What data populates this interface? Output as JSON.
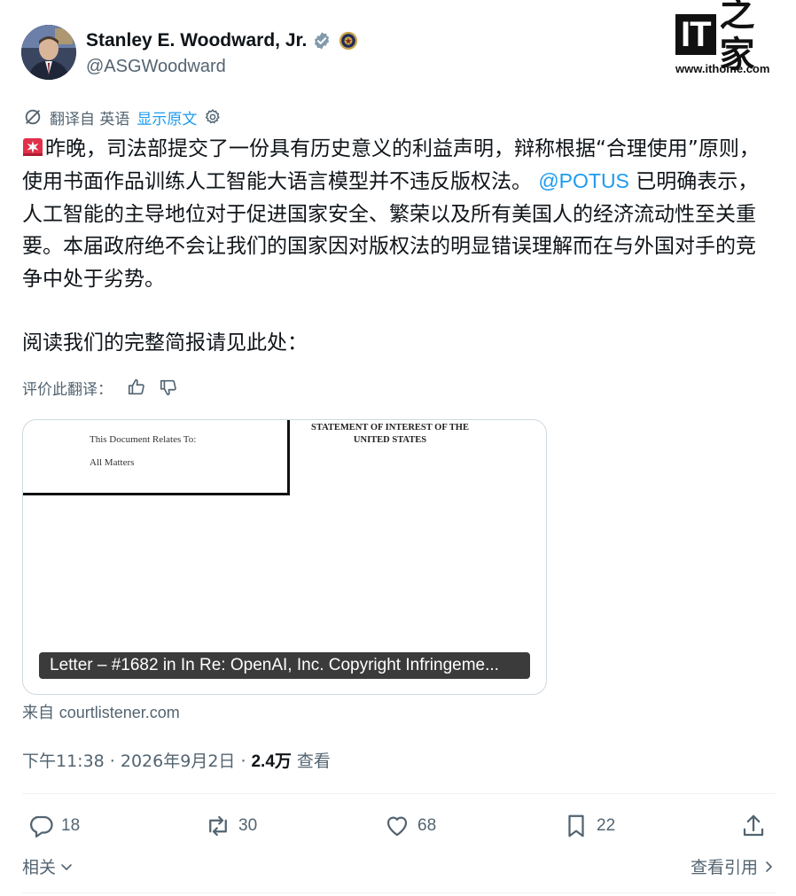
{
  "author": {
    "name": "Stanley E. Woodward, Jr.",
    "handle": "@ASGWoodward"
  },
  "watermark": {
    "logo_it": "IT",
    "logo_zh": "之家",
    "url": "www.ithome.com"
  },
  "translation": {
    "label": "翻译自 英语",
    "show_original": "显示原文"
  },
  "tweet": {
    "text_before_mention": "昨晚，司法部提交了一份具有历史意义的利益声明，辩称根据“合理使用”原则，使用书面作品训练人工智能大语言模型并不违反版权法。",
    "mention": "@POTUS",
    "text_after_mention": "已明确表示，人工智能的主导地位对于促进国家安全、繁荣以及所有美国人的经济流动性至关重要。本届政府绝不会让我们的国家因对版权法的明显错误理解而在与外国对手的竞争中处于劣势。",
    "paragraph2": "阅读我们的完整简报请见此处："
  },
  "rate_translation": "评价此翻译：",
  "card": {
    "doc_relates": "This Document Relates To:",
    "doc_all_matters": "All Matters",
    "doc_statement_line1": "STATEMENT OF INTEREST OF THE",
    "doc_statement_line2": "UNITED STATES",
    "caption": "Letter – #1682 in In Re: OpenAI, Inc. Copyright Infringeme..."
  },
  "source": {
    "prefix": "来自",
    "domain": "courtlistener.com"
  },
  "meta": {
    "time": "下午11:38 · 2026年9月2日 ·",
    "views": "2.4万",
    "views_label": "查看"
  },
  "actions": {
    "replies": "18",
    "retweets": "30",
    "likes": "68",
    "bookmarks": "22"
  },
  "bottom": {
    "related": "相关",
    "view_quotes": "查看引用"
  },
  "colors": {
    "link": "#1d9bf0",
    "secondary_text": "#536471",
    "primary_text": "#0f1419",
    "verified_badge": "#829aab"
  }
}
